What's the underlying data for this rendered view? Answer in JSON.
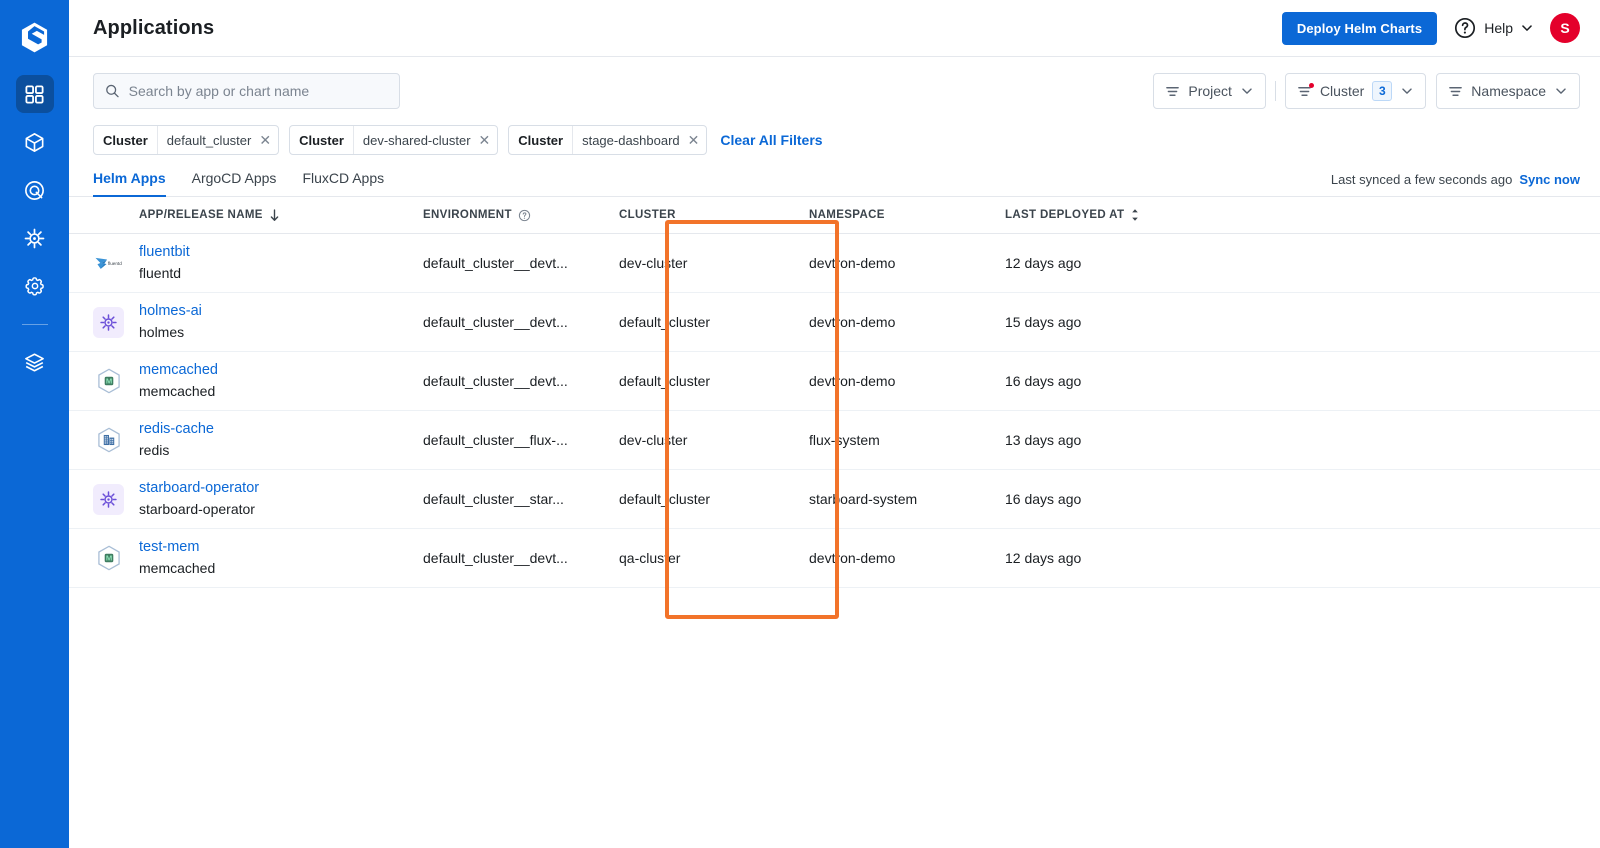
{
  "brand": {
    "logo_icon": "devtron-logo-icon",
    "primary": "#0b68d6",
    "accent_orange": "#f2732a",
    "avatar_color": "#e4002b"
  },
  "sidebar": {
    "items": [
      {
        "icon": "grid-apps-icon",
        "name": "applications",
        "active": true
      },
      {
        "icon": "cube-icon",
        "name": "jobs",
        "active": false
      },
      {
        "icon": "target-icon",
        "name": "app-groups",
        "active": false
      },
      {
        "icon": "helm-wheel-icon",
        "name": "charts",
        "active": false
      },
      {
        "icon": "gear-icon",
        "name": "global-configurations",
        "active": false
      },
      {
        "icon": "stacked-layers-icon",
        "name": "stack-manager",
        "active": false
      }
    ]
  },
  "header": {
    "title": "Applications",
    "deploy_button": "Deploy Helm Charts",
    "help_label": "Help",
    "help_icon": "question-circle-icon",
    "chevron_icon": "chevron-down-icon",
    "avatar_initial": "S"
  },
  "search": {
    "placeholder": "Search by app or chart name",
    "value": "",
    "icon": "search-icon"
  },
  "filters": {
    "dropdowns": [
      {
        "label": "Project",
        "icon": "filter-icon",
        "count": null,
        "has_dot": false
      },
      {
        "label": "Cluster",
        "icon": "filter-icon",
        "count": "3",
        "has_dot": true
      },
      {
        "label": "Namespace",
        "icon": "filter-icon",
        "count": null,
        "has_dot": false
      }
    ],
    "chips": [
      {
        "key": "Cluster",
        "value": "default_cluster"
      },
      {
        "key": "Cluster",
        "value": "dev-shared-cluster"
      },
      {
        "key": "Cluster",
        "value": "stage-dashboard"
      }
    ],
    "clear_all": "Clear All Filters"
  },
  "tabs": [
    {
      "label": "Helm Apps",
      "active": true
    },
    {
      "label": "ArgoCD Apps",
      "active": false
    },
    {
      "label": "FluxCD Apps",
      "active": false
    }
  ],
  "sync": {
    "status_text": "Last synced a few seconds ago",
    "action_label": "Sync now"
  },
  "table": {
    "columns": [
      {
        "label": "APP/RELEASE NAME",
        "sort_icon": "sort-descending-arrow-icon"
      },
      {
        "label": "ENVIRONMENT",
        "info_icon": "question-circle-icon"
      },
      {
        "label": "CLUSTER",
        "highlighted": true
      },
      {
        "label": "NAMESPACE"
      },
      {
        "label": "LAST DEPLOYED AT",
        "sort_icon": "sort-updown-arrow-icon"
      }
    ],
    "rows": [
      {
        "icon": "fluentd-logo-icon",
        "icon_style": "fluentd",
        "name": "fluentbit",
        "chart": "fluentd",
        "environment": "default_cluster__devt...",
        "cluster": "dev-cluster",
        "namespace": "devtron-demo",
        "last_deployed": "12 days ago"
      },
      {
        "icon": "helm-gear-icon",
        "icon_style": "purple",
        "name": "holmes-ai",
        "chart": "holmes",
        "environment": "default_cluster__devt...",
        "cluster": "default_cluster",
        "namespace": "devtron-demo",
        "last_deployed": "15 days ago"
      },
      {
        "icon": "memcached-logo-icon",
        "icon_style": "hex-m",
        "name": "memcached",
        "chart": "memcached",
        "environment": "default_cluster__devt...",
        "cluster": "default_cluster",
        "namespace": "devtron-demo",
        "last_deployed": "16 days ago"
      },
      {
        "icon": "redis-logo-icon",
        "icon_style": "hex-building",
        "name": "redis-cache",
        "chart": "redis",
        "environment": "default_cluster__flux-...",
        "cluster": "dev-cluster",
        "namespace": "flux-system",
        "last_deployed": "13 days ago"
      },
      {
        "icon": "helm-gear-icon",
        "icon_style": "purple",
        "name": "starboard-operator",
        "chart": "starboard-operator",
        "environment": "default_cluster__star...",
        "cluster": "default_cluster",
        "namespace": "starboard-system",
        "last_deployed": "16 days ago"
      },
      {
        "icon": "memcached-logo-icon",
        "icon_style": "hex-m",
        "name": "test-mem",
        "chart": "memcached",
        "environment": "default_cluster__devt...",
        "cluster": "qa-cluster",
        "namespace": "devtron-demo",
        "last_deployed": "12 days ago"
      }
    ]
  }
}
